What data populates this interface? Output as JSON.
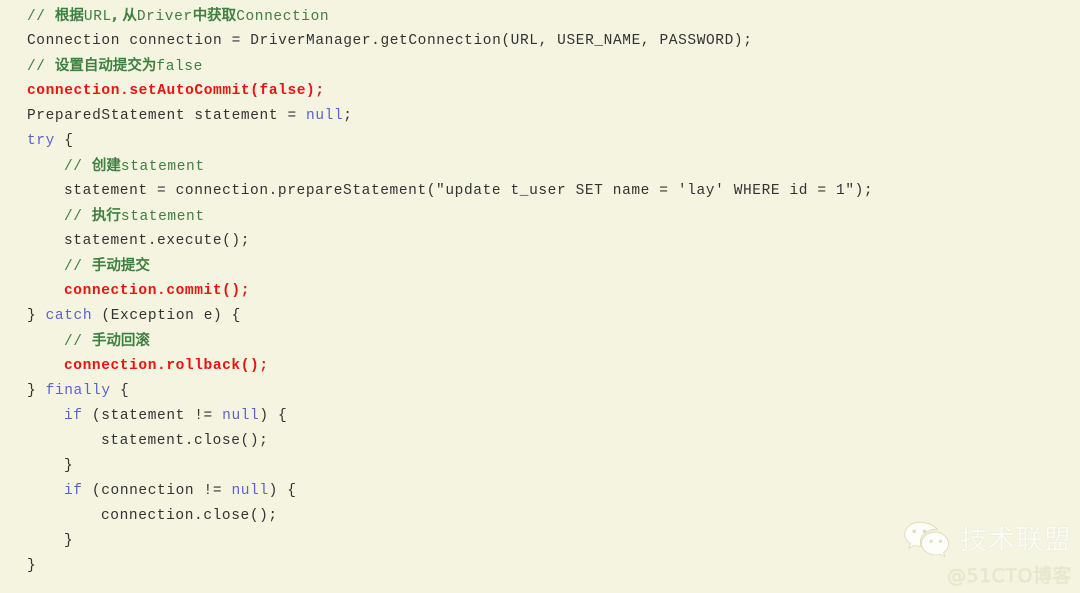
{
  "editor": {
    "background_color": "#f4f4e1",
    "default_text_color": "#333333",
    "comment_color": "#3f7f3f",
    "keyword_color": "#5b63c7",
    "highlight_call_color": "#e8140f",
    "language": "java"
  },
  "code": {
    "lines": [
      {
        "indent": 0,
        "tokens": [
          {
            "type": "comment",
            "text": "// "
          },
          {
            "type": "comment-cjk",
            "text": "根据"
          },
          {
            "type": "comment",
            "text": "URL"
          },
          {
            "type": "comment-cjk",
            "text": ", 从"
          },
          {
            "type": "comment",
            "text": "Driver"
          },
          {
            "type": "comment-cjk",
            "text": "中获取"
          },
          {
            "type": "comment",
            "text": "Connection"
          }
        ]
      },
      {
        "indent": 0,
        "tokens": [
          {
            "type": "plain",
            "text": "Connection connection = DriverManager.getConnection(URL, USER_NAME, PASSWORD);"
          }
        ]
      },
      {
        "indent": 0,
        "tokens": [
          {
            "type": "comment",
            "text": "// "
          },
          {
            "type": "comment-cjk",
            "text": "设置自动提交为"
          },
          {
            "type": "comment",
            "text": "false"
          }
        ]
      },
      {
        "indent": 0,
        "tokens": [
          {
            "type": "call",
            "text": "connection.setAutoCommit(false);"
          }
        ]
      },
      {
        "indent": 0,
        "tokens": [
          {
            "type": "plain",
            "text": "PreparedStatement statement = "
          },
          {
            "type": "literal",
            "text": "null"
          },
          {
            "type": "plain",
            "text": ";"
          }
        ]
      },
      {
        "indent": 0,
        "tokens": [
          {
            "type": "keyword",
            "text": "try"
          },
          {
            "type": "plain",
            "text": " {"
          }
        ]
      },
      {
        "indent": 1,
        "tokens": [
          {
            "type": "comment",
            "text": "// "
          },
          {
            "type": "comment-cjk",
            "text": "创建"
          },
          {
            "type": "comment",
            "text": "statement"
          }
        ]
      },
      {
        "indent": 1,
        "tokens": [
          {
            "type": "plain",
            "text": "statement = connection.prepareStatement(\"update t_user SET name = 'lay' WHERE id = 1\");"
          }
        ]
      },
      {
        "indent": 1,
        "tokens": [
          {
            "type": "comment",
            "text": "// "
          },
          {
            "type": "comment-cjk",
            "text": "执行"
          },
          {
            "type": "comment",
            "text": "statement"
          }
        ]
      },
      {
        "indent": 1,
        "tokens": [
          {
            "type": "plain",
            "text": "statement.execute();"
          }
        ]
      },
      {
        "indent": 1,
        "tokens": [
          {
            "type": "comment",
            "text": "// "
          },
          {
            "type": "comment-cjk",
            "text": "手动提交"
          }
        ]
      },
      {
        "indent": 1,
        "tokens": [
          {
            "type": "call",
            "text": "connection.commit();"
          }
        ]
      },
      {
        "indent": 0,
        "tokens": [
          {
            "type": "plain",
            "text": "} "
          },
          {
            "type": "keyword",
            "text": "catch"
          },
          {
            "type": "plain",
            "text": " (Exception e) {"
          }
        ]
      },
      {
        "indent": 1,
        "tokens": [
          {
            "type": "comment",
            "text": "// "
          },
          {
            "type": "comment-cjk",
            "text": "手动回滚"
          }
        ]
      },
      {
        "indent": 1,
        "tokens": [
          {
            "type": "call",
            "text": "connection.rollback();"
          }
        ]
      },
      {
        "indent": 0,
        "tokens": [
          {
            "type": "plain",
            "text": "} "
          },
          {
            "type": "keyword",
            "text": "finally"
          },
          {
            "type": "plain",
            "text": " {"
          }
        ]
      },
      {
        "indent": 1,
        "tokens": [
          {
            "type": "keyword",
            "text": "if"
          },
          {
            "type": "plain",
            "text": " (statement != "
          },
          {
            "type": "literal",
            "text": "null"
          },
          {
            "type": "plain",
            "text": ") {"
          }
        ]
      },
      {
        "indent": 2,
        "tokens": [
          {
            "type": "plain",
            "text": "statement.close();"
          }
        ]
      },
      {
        "indent": 1,
        "tokens": [
          {
            "type": "plain",
            "text": "}"
          }
        ]
      },
      {
        "indent": 1,
        "tokens": [
          {
            "type": "keyword",
            "text": "if"
          },
          {
            "type": "plain",
            "text": " (connection != "
          },
          {
            "type": "literal",
            "text": "null"
          },
          {
            "type": "plain",
            "text": ") {"
          }
        ]
      },
      {
        "indent": 2,
        "tokens": [
          {
            "type": "plain",
            "text": "connection.close();"
          }
        ]
      },
      {
        "indent": 1,
        "tokens": [
          {
            "type": "plain",
            "text": "}"
          }
        ]
      },
      {
        "indent": 0,
        "tokens": [
          {
            "type": "plain",
            "text": "}"
          }
        ]
      }
    ]
  },
  "watermark": {
    "icon": "wechat-icon",
    "brand": "技术联盟",
    "handle": "@51CTO博客"
  }
}
